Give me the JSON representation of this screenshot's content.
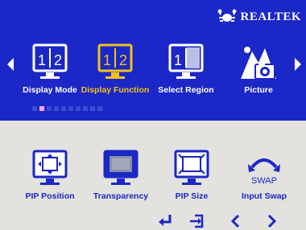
{
  "brand": {
    "name": "REALTEK",
    "logo_icon": "realtek-crab-icon"
  },
  "colors": {
    "osd_blue": "#1b27c6",
    "selected_yellow": "#f2c21a",
    "panel_grey": "#e3e2de"
  },
  "top_menu": {
    "items": [
      {
        "label": "Display Mode",
        "icon": "display-mode-icon",
        "selected": false
      },
      {
        "label": "Display Function",
        "icon": "display-function-icon",
        "selected": true
      },
      {
        "label": "Select Region",
        "icon": "select-region-icon",
        "selected": false
      },
      {
        "label": "Picture",
        "icon": "picture-icon",
        "selected": false
      }
    ],
    "page_indicator": {
      "count": 10,
      "active_index": 1
    }
  },
  "sub_menu": {
    "items": [
      {
        "label": "PIP Position",
        "icon": "pip-position-icon"
      },
      {
        "label": "Transparency",
        "icon": "transparency-icon"
      },
      {
        "label": "PIP Size",
        "icon": "pip-size-icon"
      },
      {
        "label": "Input Swap",
        "icon": "input-swap-icon",
        "icon_text": "SWAP"
      }
    ]
  },
  "top_menu_icons": {
    "display_mode_digits": [
      "1",
      "2"
    ],
    "display_function_digits": [
      "1",
      "2"
    ],
    "select_region_digit": "1"
  },
  "nav_hints": [
    "enter-icon",
    "exit-icon",
    "left-icon",
    "right-icon"
  ]
}
